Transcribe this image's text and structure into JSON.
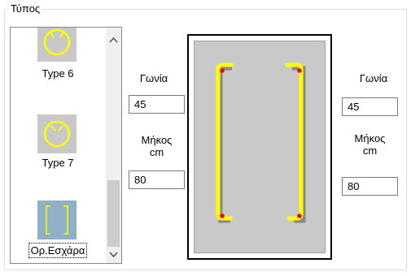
{
  "group": {
    "title": "Τύπος"
  },
  "types_list": {
    "items": [
      {
        "label": "Type 6",
        "icon": "hook-circle-icon"
      },
      {
        "label": "Type 7",
        "icon": "hook-circle-icon"
      },
      {
        "label": "Ορ.Εσχάρα",
        "icon": "mesh-bracket-icon",
        "selected": true
      }
    ],
    "scroll_up": "^",
    "scroll_down": "v"
  },
  "left": {
    "angle_label": "Γωνία",
    "angle_value": "45",
    "length_label_1": "Μήκος",
    "length_label_2": "cm",
    "length_value": "80"
  },
  "right": {
    "angle_label": "Γωνία",
    "angle_value": "45",
    "length_label_1": "Μήκος",
    "length_label_2": "cm",
    "length_value": "80"
  },
  "colors": {
    "rebar": "#ffff00",
    "anchor_dot": "#ff0000",
    "canvas_bg": "#c9c9c9",
    "thumb_mesh_bg": "#8fb0c6"
  }
}
